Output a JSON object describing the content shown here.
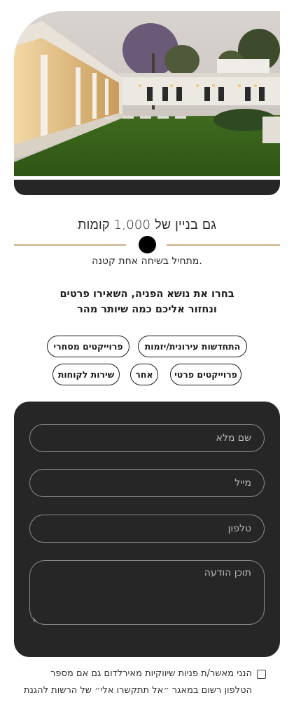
{
  "hero": {
    "image": "modern-villa-garden-dusk"
  },
  "tagline": "גם בניין של 1,000 קומות",
  "subtagline": "מתחיל בשיחה אחת קטנה.",
  "topic_heading": [
    "בחרו את נושא הפניה, השאירו פרטים",
    "ונחזור אליכם כמה שיותר מהר"
  ],
  "topics": [
    "התחדשות עירונית/יזמות",
    "פרוייקטים מסחרי",
    "פרוייקטים פרטי",
    "אחר",
    "שירות לקוחות"
  ],
  "form": {
    "full_name_placeholder": "שם מלא",
    "email_placeholder": "מייל",
    "phone_placeholder": "טלפון",
    "message_placeholder": "תוכן הודעה"
  },
  "consent": {
    "line1": "הנני מאשר/ת פניות שיווקיות מאירלדום גם אם מספר",
    "line2": "הטלפון רשום במאגר ״אל תתקשרו אלי״ של הרשות להגנת"
  },
  "colors": {
    "accent_gold": "#c7ad84",
    "form_bg": "#262626",
    "dot": "#000000"
  }
}
